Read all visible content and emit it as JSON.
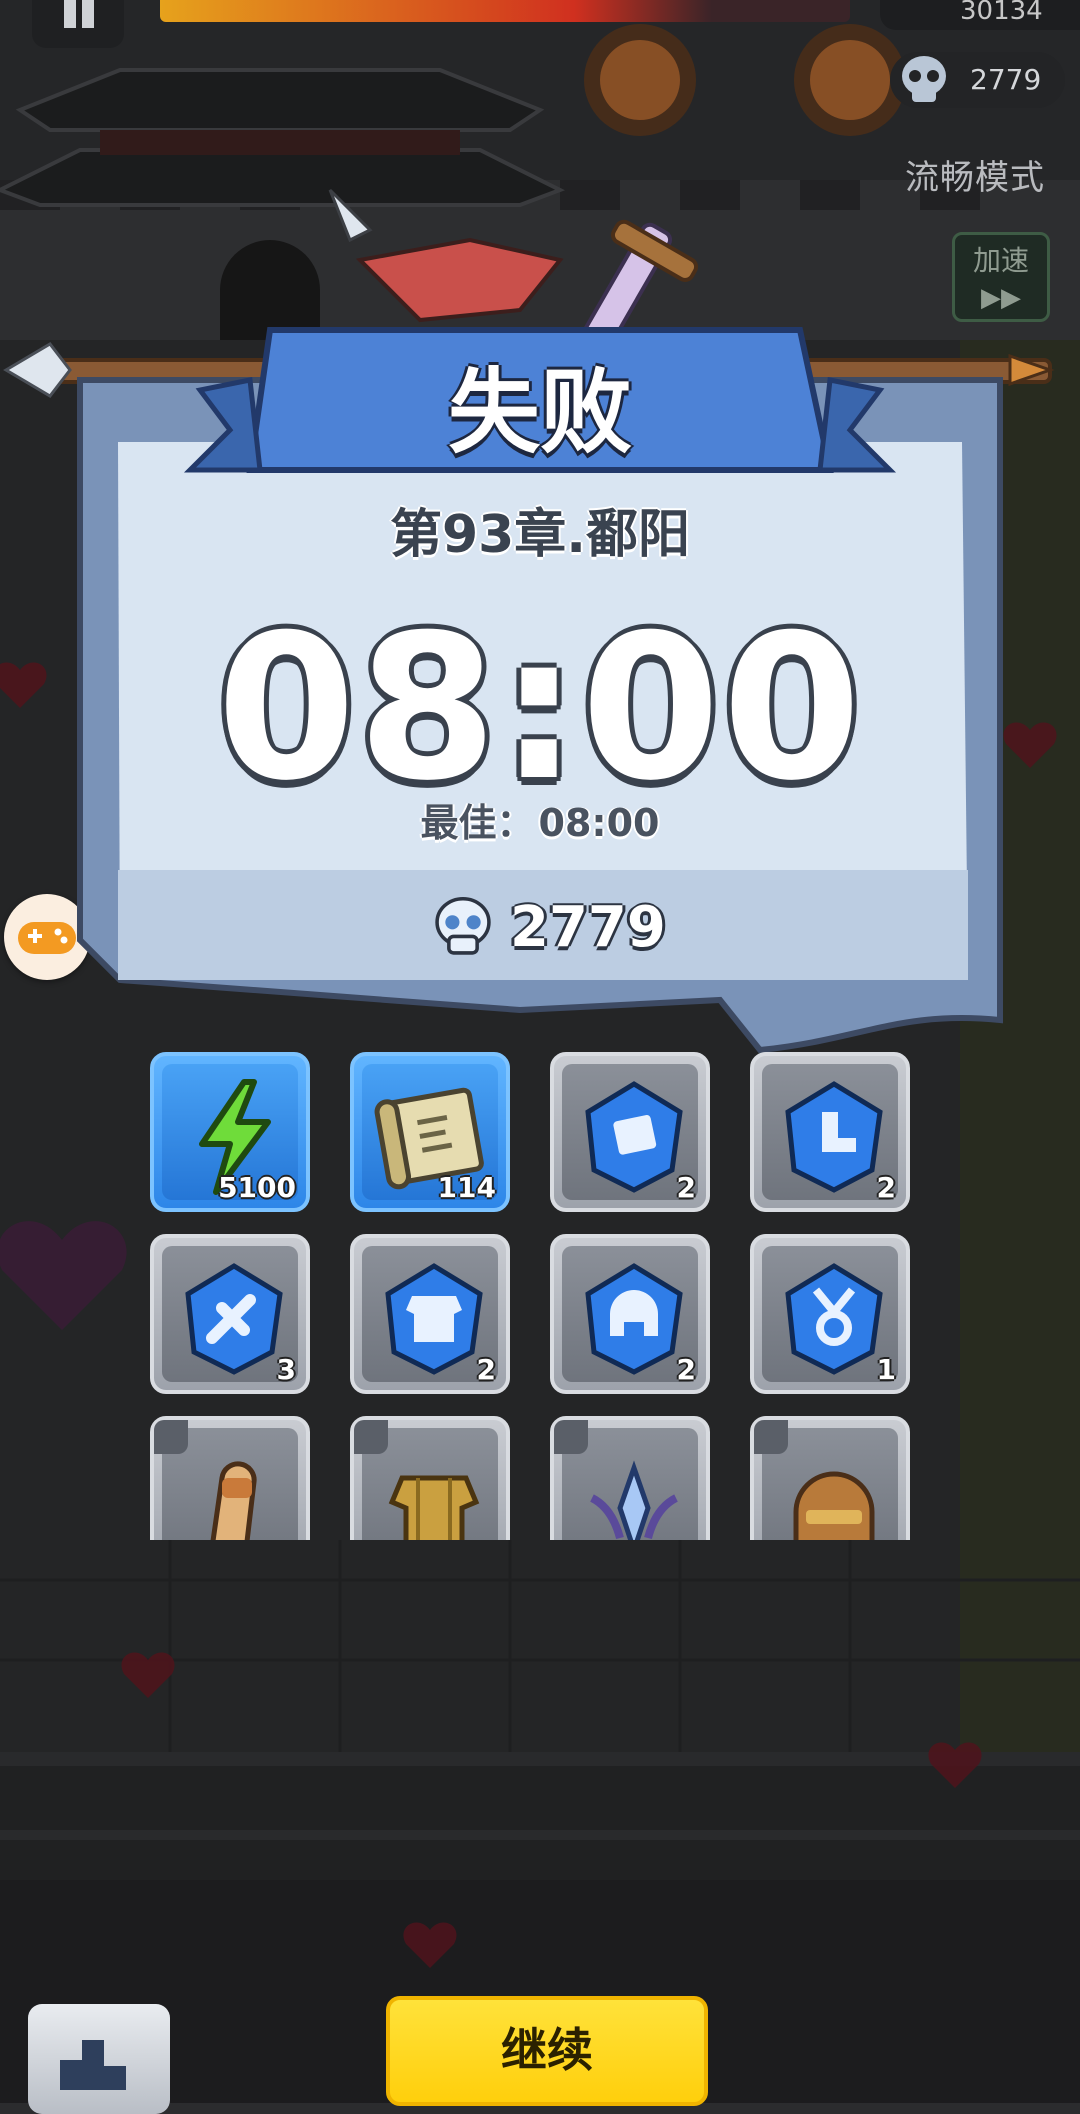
{
  "hud": {
    "coins": "30134",
    "kills": "2779",
    "mode_label": "流畅模式",
    "speed_label": "加速",
    "speed_arrows": "▶▶"
  },
  "result": {
    "title": "失败",
    "chapter": "第93章.鄱阳",
    "time": "08:00",
    "best_label": "最佳：",
    "best_time": "08:00",
    "kills": "2779"
  },
  "rewards": [
    {
      "name": "energy",
      "icon": "lightning-icon",
      "count": "5100",
      "style": "blue"
    },
    {
      "name": "scroll",
      "icon": "scroll-icon",
      "count": "114",
      "style": "blue"
    },
    {
      "name": "gem-scroll",
      "icon": "scroll-gem-icon",
      "count": "2",
      "style": "gray"
    },
    {
      "name": "gem-boot",
      "icon": "boot-gem-icon",
      "count": "2",
      "style": "gray"
    },
    {
      "name": "gem-sword",
      "icon": "sword-gem-icon",
      "count": "3",
      "style": "gray"
    },
    {
      "name": "gem-armor",
      "icon": "armor-gem-icon",
      "count": "2",
      "style": "gray"
    },
    {
      "name": "gem-helmet",
      "icon": "helmet-gem-icon",
      "count": "2",
      "style": "gray"
    },
    {
      "name": "gem-medal",
      "icon": "medal-gem-icon",
      "count": "1",
      "style": "gray"
    },
    {
      "name": "gloves",
      "icon": "gauntlet-icon",
      "count": "",
      "style": "gray"
    },
    {
      "name": "armor",
      "icon": "gold-armor-icon",
      "count": "",
      "style": "gray"
    },
    {
      "name": "crown",
      "icon": "crystal-crown-icon",
      "count": "",
      "style": "gray"
    },
    {
      "name": "helmet",
      "icon": "bronze-helmet-icon",
      "count": "",
      "style": "gray"
    }
  ],
  "buttons": {
    "continue": "继续"
  }
}
